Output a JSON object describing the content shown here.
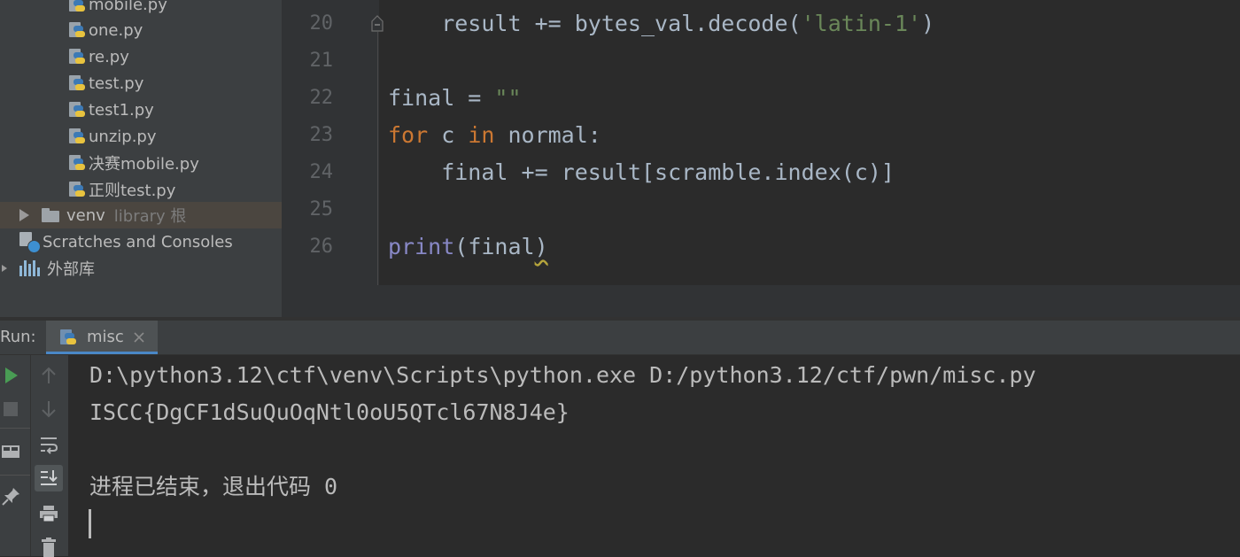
{
  "project_tree": {
    "files": [
      {
        "name": "mobile.py"
      },
      {
        "name": "one.py"
      },
      {
        "name": "re.py"
      },
      {
        "name": "test.py"
      },
      {
        "name": "test1.py"
      },
      {
        "name": "unzip.py"
      },
      {
        "name": "决赛mobile.py"
      },
      {
        "name": "正则test.py"
      }
    ],
    "venv": {
      "name": "venv",
      "hint": "library 根"
    },
    "scratches": "Scratches and Consoles",
    "external_libs": "外部库"
  },
  "editor": {
    "line_numbers": [
      "20",
      "21",
      "22",
      "23",
      "24",
      "25",
      "26"
    ],
    "lines": {
      "l20": {
        "text1": "    result += bytes_val.decode(",
        "str": "'latin-1'",
        "text2": ")"
      },
      "l22": {
        "text1": "final = ",
        "str": "\"\""
      },
      "l23": {
        "kw1": "for",
        "text1": " c ",
        "kw2": "in",
        "text2": " normal:"
      },
      "l24": {
        "text": "    final += result[scramble.index(c)]"
      },
      "l26": {
        "builtin": "print",
        "text1": "(final",
        "text2": ")"
      }
    }
  },
  "run_panel": {
    "label": "Run:",
    "tab_label": "misc",
    "console_lines": [
      "D:\\python3.12\\ctf\\venv\\Scripts\\python.exe D:/python3.12/ctf/pwn/misc.py",
      "ISCC{DgCF1dSuQuOqNtl0oU5QTcl67N8J4e}",
      "",
      "进程已结束，退出代码 0"
    ]
  },
  "colors": {
    "keyword": "#cc7832",
    "string": "#6a8759",
    "builtin": "#8888c6",
    "text": "#a9b7c6",
    "run_green": "#499c54",
    "tab_underline": "#4a88c7"
  },
  "icons": {
    "python_file": "python-file-icon",
    "folder": "folder-icon",
    "expand": "expand-arrow-icon",
    "scratches": "scratches-icon",
    "libraries": "library-icon",
    "run": "run-icon",
    "stop": "stop-icon",
    "scroll_up": "arrow-up-icon",
    "scroll_down": "arrow-down-icon",
    "soft_wrap": "soft-wrap-icon",
    "scroll_to_end": "scroll-to-end-icon",
    "print": "print-icon",
    "delete": "trash-icon",
    "layout": "layout-icon",
    "pin": "pin-icon",
    "close_tab": "close-icon"
  }
}
